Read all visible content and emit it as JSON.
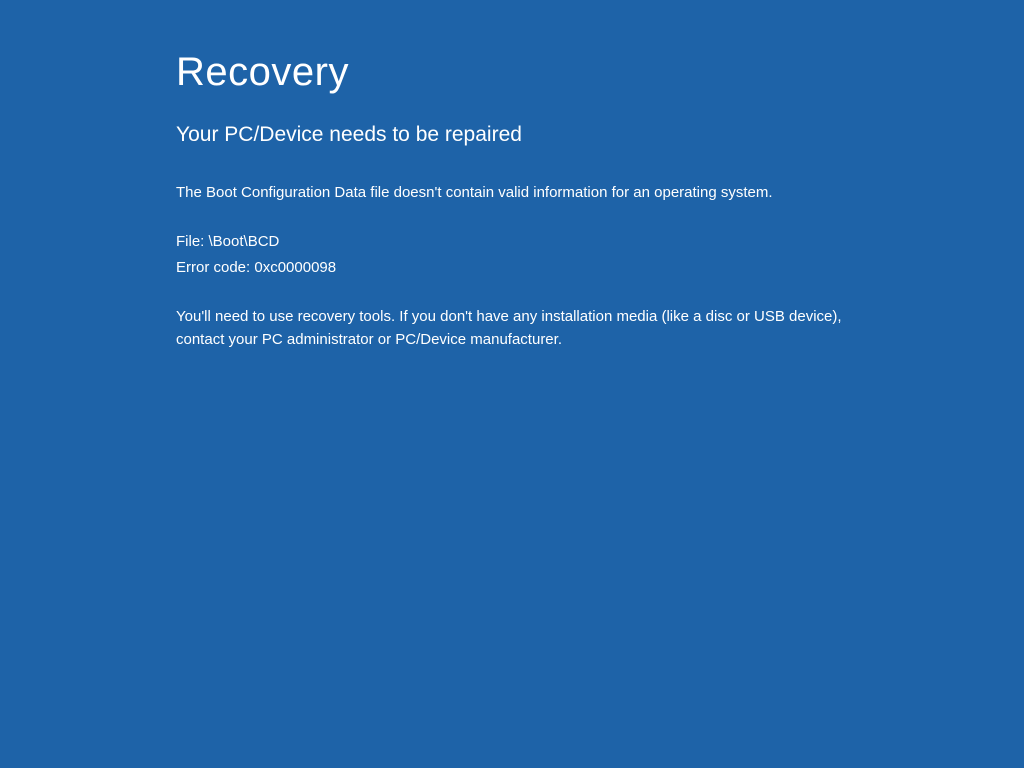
{
  "recovery": {
    "title": "Recovery",
    "subtitle": "Your PC/Device needs to be repaired",
    "description": "The Boot Configuration Data file doesn't contain valid information for an operating system.",
    "file_line": "File: \\Boot\\BCD",
    "error_code": "Error code: 0xc0000098",
    "instructions": "You'll need to use recovery tools. If you don't have any installation media (like a disc or USB device), contact your PC administrator or PC/Device manufacturer."
  }
}
